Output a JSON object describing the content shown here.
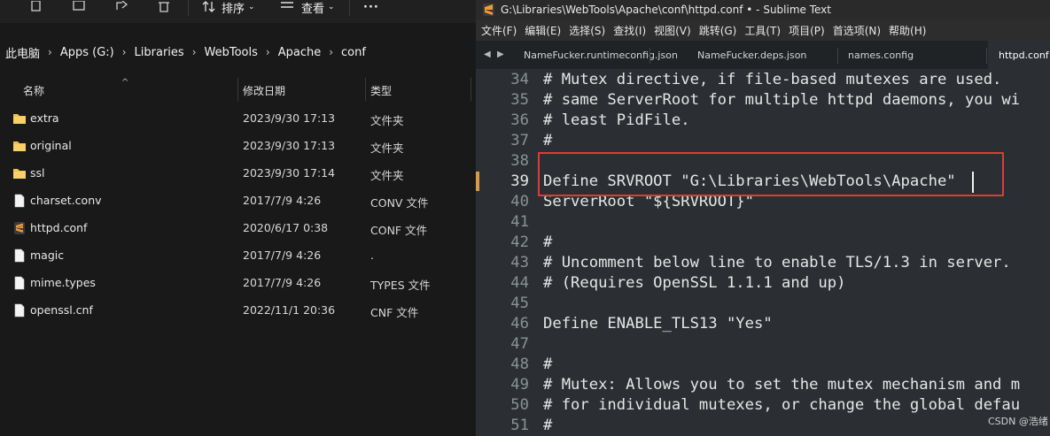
{
  "explorer": {
    "toolbar": {
      "sort_label": "排序",
      "view_label": "查看",
      "more_label": "···"
    },
    "breadcrumb": [
      "此电脑",
      "Apps (G:)",
      "Libraries",
      "WebTools",
      "Apache",
      "conf"
    ],
    "columns": {
      "name": "名称",
      "modified": "修改日期",
      "type": "类型"
    },
    "files": [
      {
        "name": "extra",
        "modified": "2023/9/30 17:13",
        "type": "文件夹",
        "icon": "folder-icon"
      },
      {
        "name": "original",
        "modified": "2023/9/30 17:13",
        "type": "文件夹",
        "icon": "folder-icon"
      },
      {
        "name": "ssl",
        "modified": "2023/9/30 17:14",
        "type": "文件夹",
        "icon": "folder-icon"
      },
      {
        "name": "charset.conv",
        "modified": "2017/7/9 4:26",
        "type": "CONV 文件",
        "icon": "file-icon"
      },
      {
        "name": "httpd.conf",
        "modified": "2020/6/17 0:38",
        "type": "CONF 文件",
        "icon": "sublime-file-icon"
      },
      {
        "name": "magic",
        "modified": "2017/7/9 4:26",
        "type": ".",
        "icon": "file-icon"
      },
      {
        "name": "mime.types",
        "modified": "2017/7/9 4:26",
        "type": "TYPES 文件",
        "icon": "file-icon"
      },
      {
        "name": "openssl.cnf",
        "modified": "2022/11/1 20:36",
        "type": "CNF 文件",
        "icon": "file-icon"
      }
    ]
  },
  "sublime": {
    "title": "G:\\Libraries\\WebTools\\Apache\\conf\\httpd.conf • - Sublime Text",
    "menu": [
      "文件(F)",
      "编辑(E)",
      "选择(S)",
      "查找(I)",
      "视图(V)",
      "跳转(G)",
      "工具(T)",
      "项目(P)",
      "首选项(N)",
      "帮助(H)"
    ],
    "tabs": [
      "NameFucker.runtimeconfig.json",
      "NameFucker.deps.json",
      "names.config",
      "httpd.conf"
    ],
    "active_tab": "httpd.conf",
    "lines": [
      {
        "num": "34",
        "text": "# Mutex directive, if file-based mutexes are used."
      },
      {
        "num": "35",
        "text": "# same ServerRoot for multiple httpd daemons, you wi"
      },
      {
        "num": "36",
        "text": "# least PidFile."
      },
      {
        "num": "37",
        "text": "#"
      },
      {
        "num": "38",
        "text": ""
      },
      {
        "num": "39",
        "text": "Define SRVROOT \"G:\\Libraries\\WebTools\\Apache\""
      },
      {
        "num": "40",
        "text": "ServerRoot \"${SRVROOT}\""
      },
      {
        "num": "41",
        "text": ""
      },
      {
        "num": "42",
        "text": "#"
      },
      {
        "num": "43",
        "text": "# Uncomment below line to enable TLS/1.3 in server."
      },
      {
        "num": "44",
        "text": "# (Requires OpenSSL 1.1.1 and up)"
      },
      {
        "num": "45",
        "text": ""
      },
      {
        "num": "46",
        "text": "Define ENABLE_TLS13 \"Yes\""
      },
      {
        "num": "47",
        "text": ""
      },
      {
        "num": "48",
        "text": "#"
      },
      {
        "num": "49",
        "text": "# Mutex: Allows you to set the mutex mechanism and m"
      },
      {
        "num": "50",
        "text": "# for individual mutexes, or change the global defau"
      },
      {
        "num": "51",
        "text": "#"
      }
    ],
    "current_line": "39",
    "watermark": "CSDN @浩绪"
  },
  "colors": {
    "highlight_box": "#e03a3a",
    "line_marker": "#d89a4a",
    "folder": "#f2c14e",
    "sublime_orange": "#f29b38"
  }
}
